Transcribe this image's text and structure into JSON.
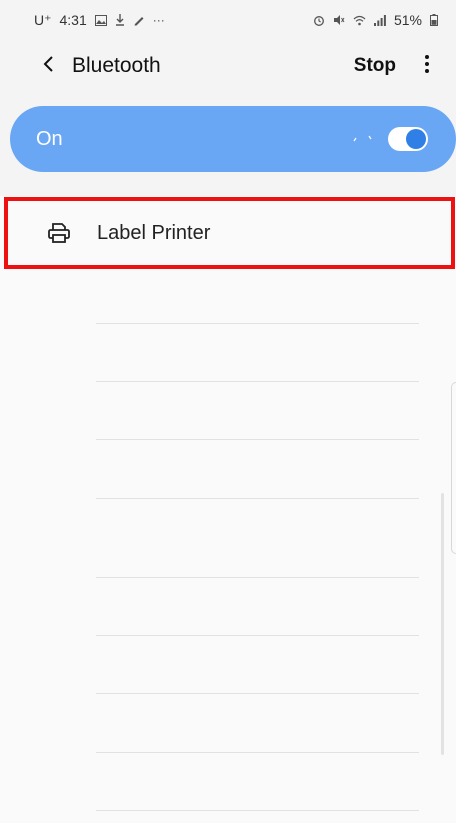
{
  "status_bar": {
    "carrier": "U⁺",
    "time": "4:31",
    "notification_icons": [
      "image-icon",
      "download-icon",
      "pen-icon",
      "more-notifications-icon"
    ],
    "system_icons": [
      "alarm-icon",
      "mute-icon",
      "wifi-icon",
      "signal-icon",
      "battery-icon"
    ],
    "battery": "51%"
  },
  "app_bar": {
    "title": "Bluetooth",
    "stop_label": "Stop"
  },
  "toggle": {
    "label": "On",
    "state": true,
    "accent_color": "#69a7f5"
  },
  "devices": [
    {
      "name": "Label Printer",
      "icon": "printer-icon"
    }
  ],
  "highlight_color": "#e11111"
}
